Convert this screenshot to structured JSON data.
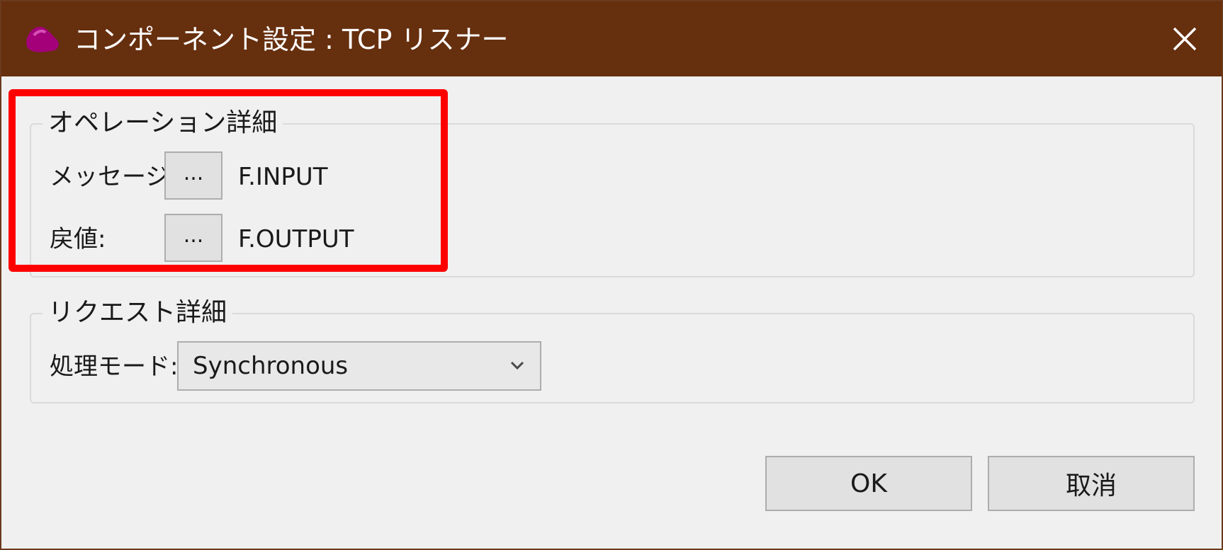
{
  "window": {
    "title": "コンポーネント設定 : TCP リスナー",
    "title_bar_color": "#662f0e",
    "close_icon": "close-icon"
  },
  "operation_details": {
    "legend": "オペレーション詳細",
    "message_label": "メッセージ:",
    "message_button": "...",
    "message_value": "F.INPUT",
    "return_label": "戻値:",
    "return_button": "...",
    "return_value": "F.OUTPUT",
    "highlight_color": "#ff0000"
  },
  "request_details": {
    "legend": "リクエスト詳細",
    "mode_label": "処理モード:",
    "mode_selected": "Synchronous"
  },
  "buttons": {
    "ok": "OK",
    "cancel": "取消"
  }
}
